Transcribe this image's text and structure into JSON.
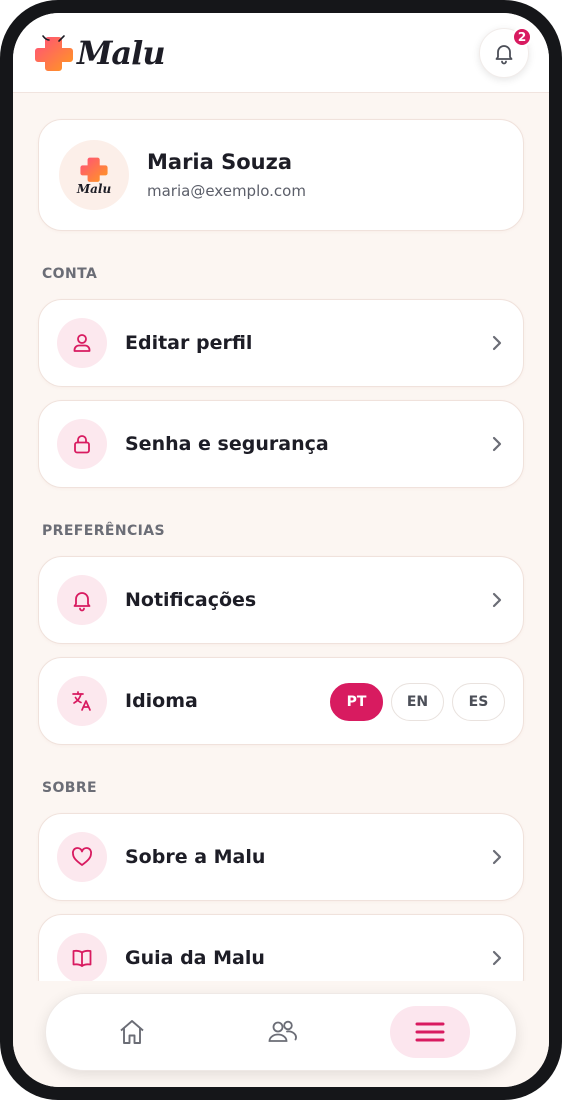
{
  "app": {
    "name": "Malu"
  },
  "header": {
    "logo_text": "Malu",
    "notification_count": "2"
  },
  "profile": {
    "name": "Maria Souza",
    "email": "maria@exemplo.com",
    "avatar_text": "Malu"
  },
  "sections": {
    "account": {
      "title": "CONTA",
      "items": [
        {
          "label": "Editar perfil",
          "icon": "user-icon"
        },
        {
          "label": "Senha e segurança",
          "icon": "lock-icon"
        }
      ]
    },
    "preferences": {
      "title": "PREFERÊNCIAS",
      "items": [
        {
          "label": "Notificações",
          "icon": "bell-icon"
        },
        {
          "label": "Idioma",
          "icon": "translate-icon"
        }
      ],
      "languages": [
        {
          "code": "PT",
          "selected": true
        },
        {
          "code": "EN",
          "selected": false
        },
        {
          "code": "ES",
          "selected": false
        }
      ]
    },
    "about": {
      "title": "SOBRE",
      "items": [
        {
          "label": "Sobre a Malu",
          "icon": "heart-icon"
        },
        {
          "label": "Guia da Malu",
          "icon": "book-icon"
        }
      ]
    }
  },
  "bottom_nav": {
    "items": [
      {
        "icon": "home-icon",
        "active": false
      },
      {
        "icon": "people-icon",
        "active": false
      },
      {
        "icon": "menu-icon",
        "active": true
      }
    ]
  },
  "colors": {
    "accent": "#d81b60",
    "accent_soft": "#fce8ee",
    "background": "#fcf6f2",
    "text": "#1d1d26"
  }
}
